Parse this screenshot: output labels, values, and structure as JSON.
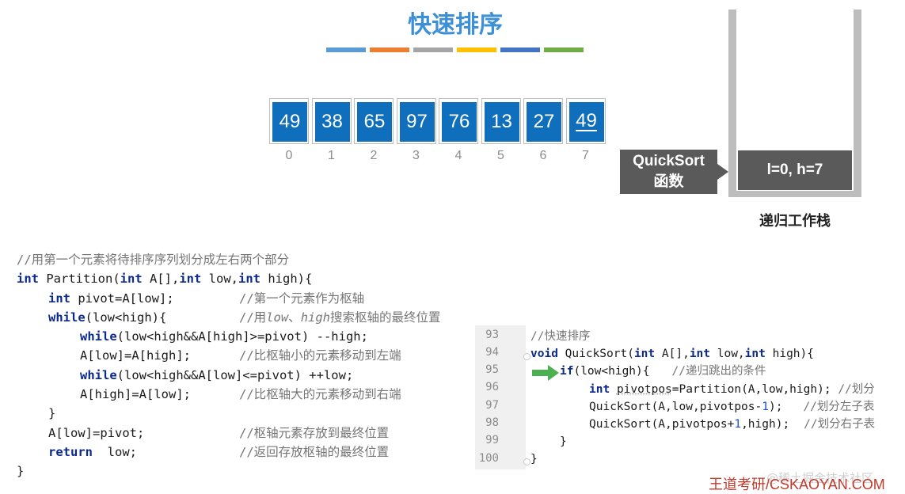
{
  "title": "快速排序",
  "color_bar_colors": [
    "#5b9bd5",
    "#ed7d31",
    "#a5a5a5",
    "#ffc000",
    "#4472c4",
    "#70ad47"
  ],
  "array": {
    "values": [
      "49",
      "38",
      "65",
      "97",
      "76",
      "13",
      "27",
      "49"
    ],
    "indices": [
      "0",
      "1",
      "2",
      "3",
      "4",
      "5",
      "6",
      "7"
    ],
    "box_color": "#0f6fbd"
  },
  "quicksort_label": {
    "line1": "QuickSort",
    "line2": "函数"
  },
  "stack": {
    "frame": "l=0, h=7",
    "caption": "递归工作栈"
  },
  "partition_code": {
    "l0": "//用第一个元素将待排序序列划分成左右两个部分",
    "l1_kw1": "int",
    "l1_a": " Partition(",
    "l1_kw2": "int",
    "l1_b": " A[],",
    "l1_kw3": "int",
    "l1_c": " low,",
    "l1_kw4": "int",
    "l1_d": " high){",
    "l2_kw": "int",
    "l2_a": " pivot=A[low];",
    "l2_cm": "//第一个元素作为枢轴",
    "l3_kw": "while",
    "l3_a": "(low<high){",
    "l3_cm1": "//用",
    "l3_it1": "low",
    "l3_cm2": "、",
    "l3_it2": "high",
    "l3_cm3": "搜索枢轴的最终位置",
    "l4_kw": "while",
    "l4_a": "(low<high&&A[high]>=pivot) --high;",
    "l5_a": "A[low]=A[high];",
    "l5_cm": "//比枢轴小的元素移动到左端",
    "l6_kw": "while",
    "l6_a": "(low<high&&A[low]<=pivot) ++low;",
    "l7_a": "A[high]=A[low];",
    "l7_cm": "//比枢轴大的元素移动到右端",
    "l8": "}",
    "l9_a": "A[low]=pivot;",
    "l9_cm": "//枢轴元素存放到最终位置",
    "l10_kw": "return",
    "l10_a": "  low;",
    "l10_cm": "//返回存放枢轴的最终位置",
    "l11": "}"
  },
  "editor": {
    "line_numbers": [
      "93",
      "94",
      "95",
      "96",
      "97",
      "98",
      "99",
      "100"
    ],
    "l93": "//快速排序",
    "l94_kw1": "void",
    "l94_a": " QuickSort(",
    "l94_kw2": "int",
    "l94_b": " A[],",
    "l94_kw3": "int",
    "l94_c": " low,",
    "l94_kw4": "int",
    "l94_d": " high){",
    "l95_kw": "if",
    "l95_a": "(low<high){",
    "l95_cm": "//递归跳出的条件",
    "l96_kw": "int",
    "l96_var": "pivotpos",
    "l96_a": "=Partition(A,low,high);",
    "l96_cm": "//划分",
    "l97_a": "QuickSort(A,low,pivotpos-",
    "l97_num": "1",
    "l97_b": ");",
    "l97_cm": "//划分左子表",
    "l98_a": "QuickSort(A,pivotpos+",
    "l98_num": "1",
    "l98_b": ",high);",
    "l98_cm": "//划分右子表",
    "l99": "}",
    "l100": "}",
    "arrow_color": "#4caf50"
  },
  "watermark": "王道考研/CSKAOYAN.COM",
  "watermark_faint": "@稀土掘金技术社区"
}
